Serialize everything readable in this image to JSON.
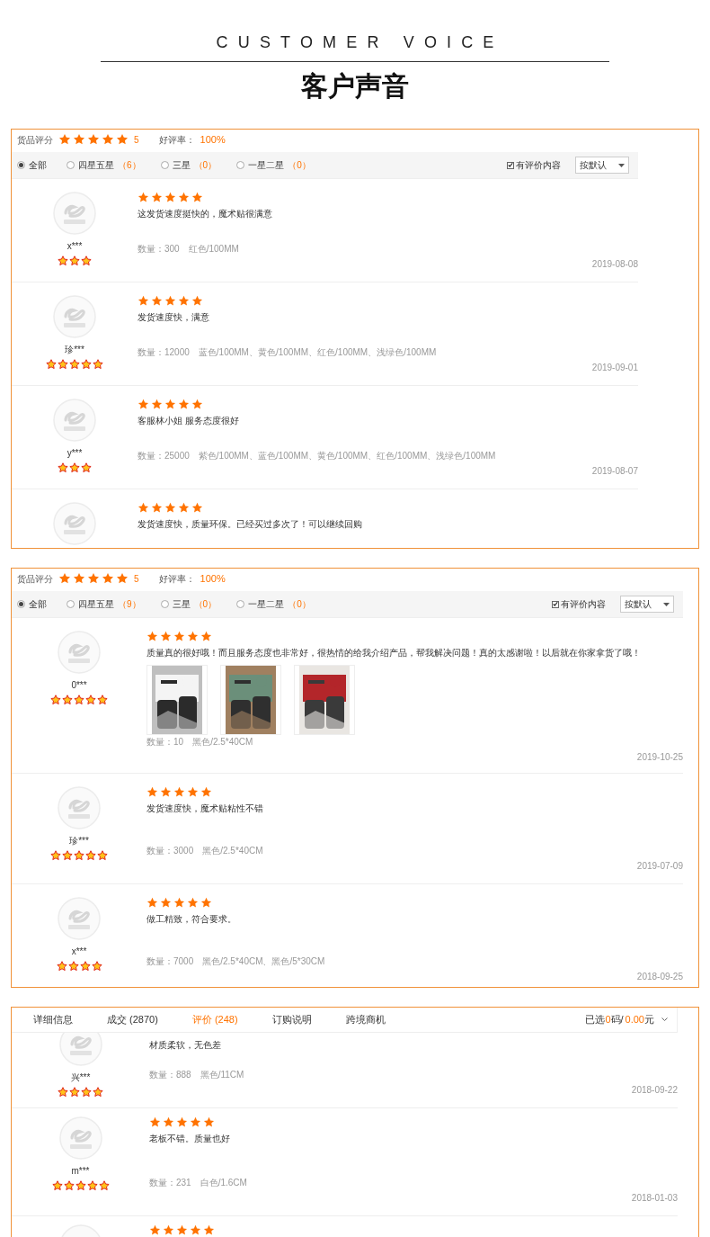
{
  "header": {
    "subtitle": "CUSTOMER VOICE",
    "title": "客户声音"
  },
  "panels": [
    {
      "kind": "filtered",
      "summary": {
        "label": "货品评分",
        "stars": 5,
        "score": "5",
        "rate_label": "好评率：",
        "rate": "100%"
      },
      "filters": [
        {
          "label": "全部",
          "selected": true
        },
        {
          "label": "四星五星",
          "count": "（6）",
          "selected": false
        },
        {
          "label": "三星",
          "count": "（0）",
          "selected": false
        },
        {
          "label": "一星二星",
          "count": "（0）",
          "selected": false
        }
      ],
      "only_with_content": {
        "label": "有评价内容",
        "checked": true
      },
      "sort": {
        "value": "按默认"
      },
      "reviews": [
        {
          "user": "x***",
          "buyer_rank": {
            "stars": 3
          },
          "stars": 5,
          "text": "这发货速度挺快的，魔术贴很满意",
          "quantity": "数量：300",
          "spec": "红色/100MM",
          "date": "2019-08-08"
        },
        {
          "user": "珍***",
          "buyer_rank": {
            "stars": 5
          },
          "stars": 5,
          "text": "发货速度快，满意",
          "quantity": "数量：12000",
          "spec": "蓝色/100MM、黄色/100MM、红色/100MM、浅绿色/100MM",
          "date": "2019-09-01"
        },
        {
          "user": "y***",
          "buyer_rank": {
            "stars": 3
          },
          "stars": 5,
          "text": "客服林小姐 服务态度很好",
          "quantity": "数量：25000",
          "spec": "紫色/100MM、蓝色/100MM、黄色/100MM、红色/100MM、浅绿色/100MM",
          "date": "2019-08-07"
        },
        {
          "stars": 5,
          "text": "发货速度快，质量环保。已经买过多次了！可以继续回购"
        }
      ]
    },
    {
      "kind": "filtered",
      "summary": {
        "label": "货品评分",
        "stars": 5,
        "score": "5",
        "rate_label": "好评率：",
        "rate": "100%"
      },
      "filters": [
        {
          "label": "全部",
          "selected": true
        },
        {
          "label": "四星五星",
          "count": "（9）",
          "selected": false
        },
        {
          "label": "三星",
          "count": "（0）",
          "selected": false
        },
        {
          "label": "一星二星",
          "count": "（0）",
          "selected": false
        }
      ],
      "only_with_content": {
        "label": "有评价内容",
        "checked": true
      },
      "sort": {
        "value": "按默认"
      },
      "reviews": [
        {
          "user": "0***",
          "buyer_rank": {
            "stars": 5
          },
          "stars": 5,
          "text": "质量真的很好哦！而且服务态度也非常好，很热情的给我介绍产品，帮我解决问题！真的太感谢啦！以后就在你家拿货了哦！",
          "photos": [
            {
              "kind": "picture"
            },
            {
              "kind": "picture"
            },
            {
              "kind": "picture"
            }
          ],
          "quantity": "数量：10",
          "spec": "黑色/2.5*40CM",
          "date": "2019-10-25"
        },
        {
          "user": "珍***",
          "buyer_rank": {
            "stars": 5
          },
          "stars": 5,
          "text": "发货速度快，魔术贴粘性不错",
          "quantity": "数量：3000",
          "spec": "黑色/2.5*40CM",
          "date": "2019-07-09"
        },
        {
          "user": "x***",
          "buyer_rank": {
            "stars": 4
          },
          "stars": 5,
          "text": "做工精致，符合要求。",
          "quantity": "数量：7000",
          "spec": "黑色/2.5*40CM、黑色/5*30CM",
          "date": "2018-09-25"
        }
      ]
    },
    {
      "kind": "tabbed",
      "tabs": [
        {
          "label": "详细信息",
          "selected": false
        },
        {
          "label": "成交 (2870)",
          "selected": false
        },
        {
          "label": "评价 (248)",
          "selected": true
        },
        {
          "label": "订购说明",
          "selected": false
        },
        {
          "label": "跨境商机",
          "selected": false
        }
      ],
      "cart": {
        "prefix": "已选",
        "count": "0",
        "unit": "码/",
        "amount": "0.00",
        "currency": "元"
      },
      "reviews": [
        {
          "user": "兴***",
          "buyer_rank": {
            "stars": 4
          },
          "text": "材质柔软，无色差",
          "quantity": "数量：888",
          "spec": "黑色/11CM",
          "date": "2018-09-22"
        },
        {
          "user": "m***",
          "buyer_rank": {
            "stars": 5
          },
          "stars": 5,
          "text": "老板不错。质量也好",
          "quantity": "数量：231",
          "spec": "白色/1.6CM",
          "date": "2018-01-03"
        },
        {
          "stars": 5
        }
      ]
    }
  ]
}
